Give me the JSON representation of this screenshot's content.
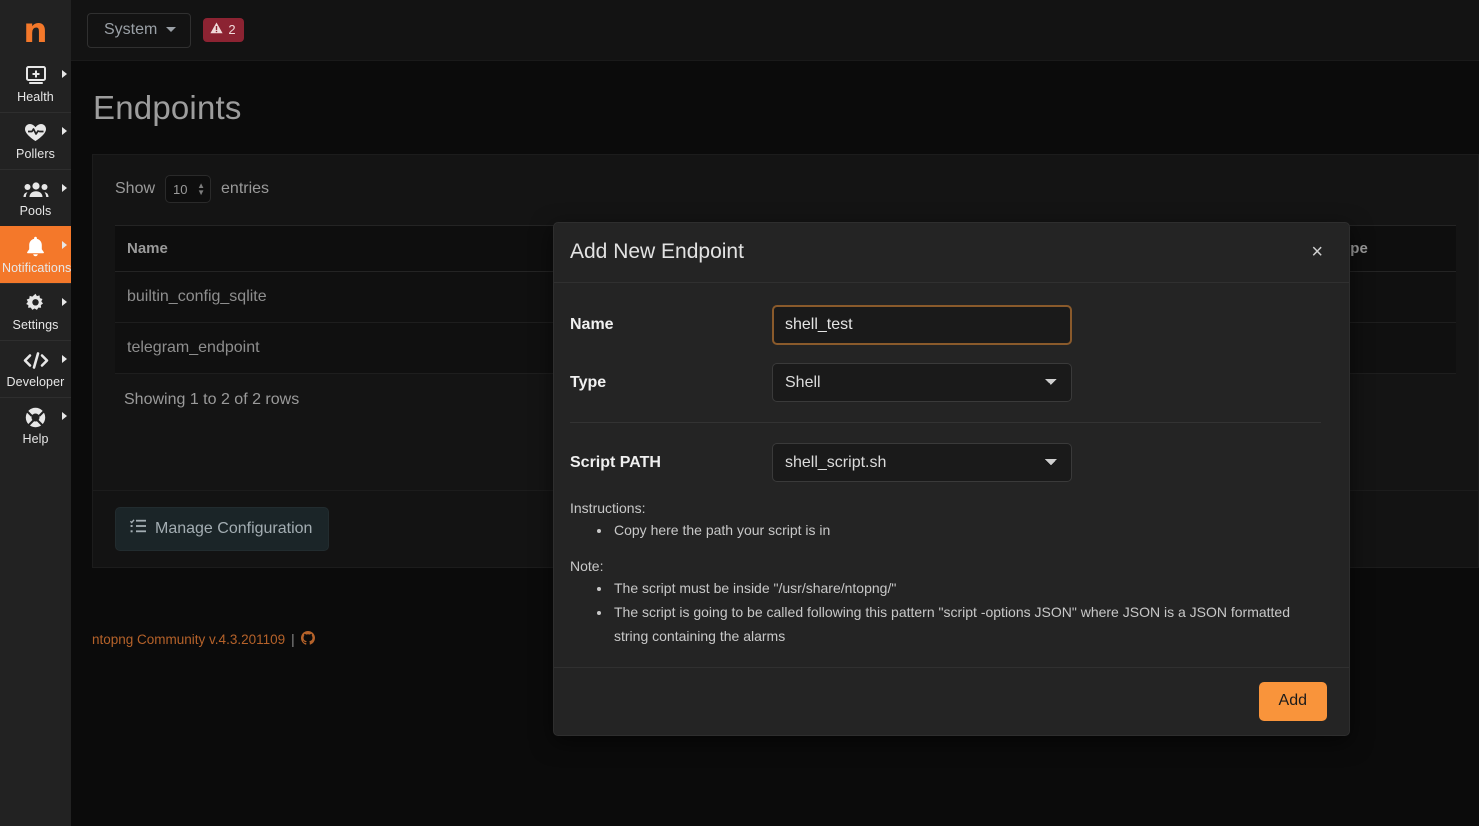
{
  "sidebar": {
    "logo": "n",
    "items": [
      {
        "label": "Health",
        "icon": "health-monitor-icon",
        "active": false
      },
      {
        "label": "Pollers",
        "icon": "heartbeat-icon",
        "active": false
      },
      {
        "label": "Pools",
        "icon": "users-group-icon",
        "active": false
      },
      {
        "label": "Notifications",
        "icon": "bell-icon",
        "active": true
      },
      {
        "label": "Settings",
        "icon": "gear-icon",
        "active": false
      },
      {
        "label": "Developer",
        "icon": "code-brackets-icon",
        "active": false
      },
      {
        "label": "Help",
        "icon": "lifebuoy-icon",
        "active": false
      }
    ]
  },
  "topbar": {
    "system_dropdown_label": "System",
    "alert_badge_count": "2",
    "alert_badge_icon": "warning-triangle-icon"
  },
  "page": {
    "title": "Endpoints"
  },
  "table_controls": {
    "show_label": "Show",
    "entries_value": "10",
    "entries_label": "entries"
  },
  "table": {
    "columns": [
      "Name",
      "Type"
    ],
    "rows": [
      {
        "name": "builtin_config_sqlite"
      },
      {
        "name": "telegram_endpoint"
      }
    ],
    "showing_text": "Showing 1 to 2 of 2 rows"
  },
  "actions": {
    "manage_configuration_label": "Manage Configuration",
    "manage_configuration_icon": "list-tasks-icon"
  },
  "footer": {
    "version_text": "ntopng Community v.4.3.201109",
    "separator": "|",
    "github_icon": "github-icon"
  },
  "modal": {
    "title": "Add New Endpoint",
    "close_label": "×",
    "fields": {
      "name": {
        "label": "Name",
        "value": "shell_test",
        "placeholder": ""
      },
      "type": {
        "label": "Type",
        "value": "Shell",
        "options": [
          "Shell"
        ]
      },
      "script_path": {
        "label": "Script PATH",
        "value": "shell_script.sh",
        "options": [
          "shell_script.sh"
        ]
      }
    },
    "instructions_heading": "Instructions:",
    "instructions": [
      "Copy here the path your script is in"
    ],
    "note_heading": "Note:",
    "notes": [
      "The script must be inside \"/usr/share/ntopng/\"",
      "The script is going to be called following this pattern \"script -options JSON\" where JSON is a JSON formatted string containing the alarms"
    ],
    "submit_label": "Add"
  },
  "colors": {
    "accent_orange": "#f4782a",
    "submit_orange": "#f9943b",
    "focus_border": "#8a5a2b",
    "alert_red": "#8c2332",
    "footer_link": "#b5622a",
    "sidebar_bg": "#222222",
    "modal_bg": "#242424",
    "page_bg": "#0b0b0b"
  }
}
